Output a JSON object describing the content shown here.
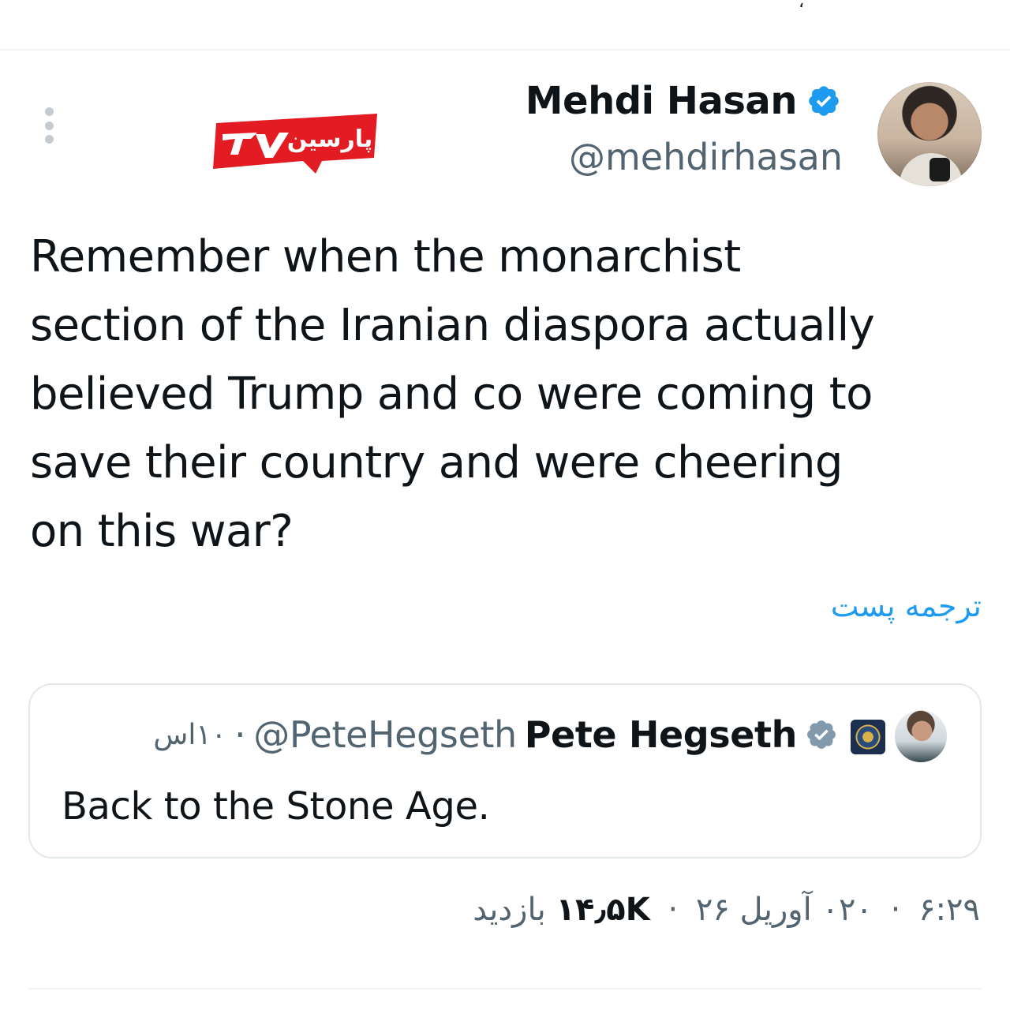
{
  "tweet": {
    "author": {
      "display_name": "Mehdi Hasan",
      "handle": "@mehdirhasan",
      "verified_icon": "verified-badge-icon"
    },
    "watermark": {
      "brand_text": "پارسین TV",
      "colors": {
        "red": "#e31b23",
        "white": "#ffffff"
      }
    },
    "text": "Remember when the monarchist\nsection of the Iranian diaspora actually\nbelieved Trump and co were coming to\nsave their country and were cheering\non this war?",
    "translate_label": "ترجمه پست",
    "quote": {
      "display_name": "Pete Hegseth",
      "handle": "@PeteHegseth",
      "time": "۱۰اس",
      "separator": "·",
      "text": "Back to the Stone Age."
    },
    "meta": {
      "time": "۶:۲۹",
      "date": "۰۲۰ آوریل ۲۶",
      "views_count": "۱۴٫۵K",
      "views_label": "بازدید",
      "separator": "·"
    }
  },
  "colors": {
    "accent": "#1d9bf0",
    "text_primary": "#0f1419",
    "text_secondary": "#536471",
    "border": "#e3e8eb"
  }
}
